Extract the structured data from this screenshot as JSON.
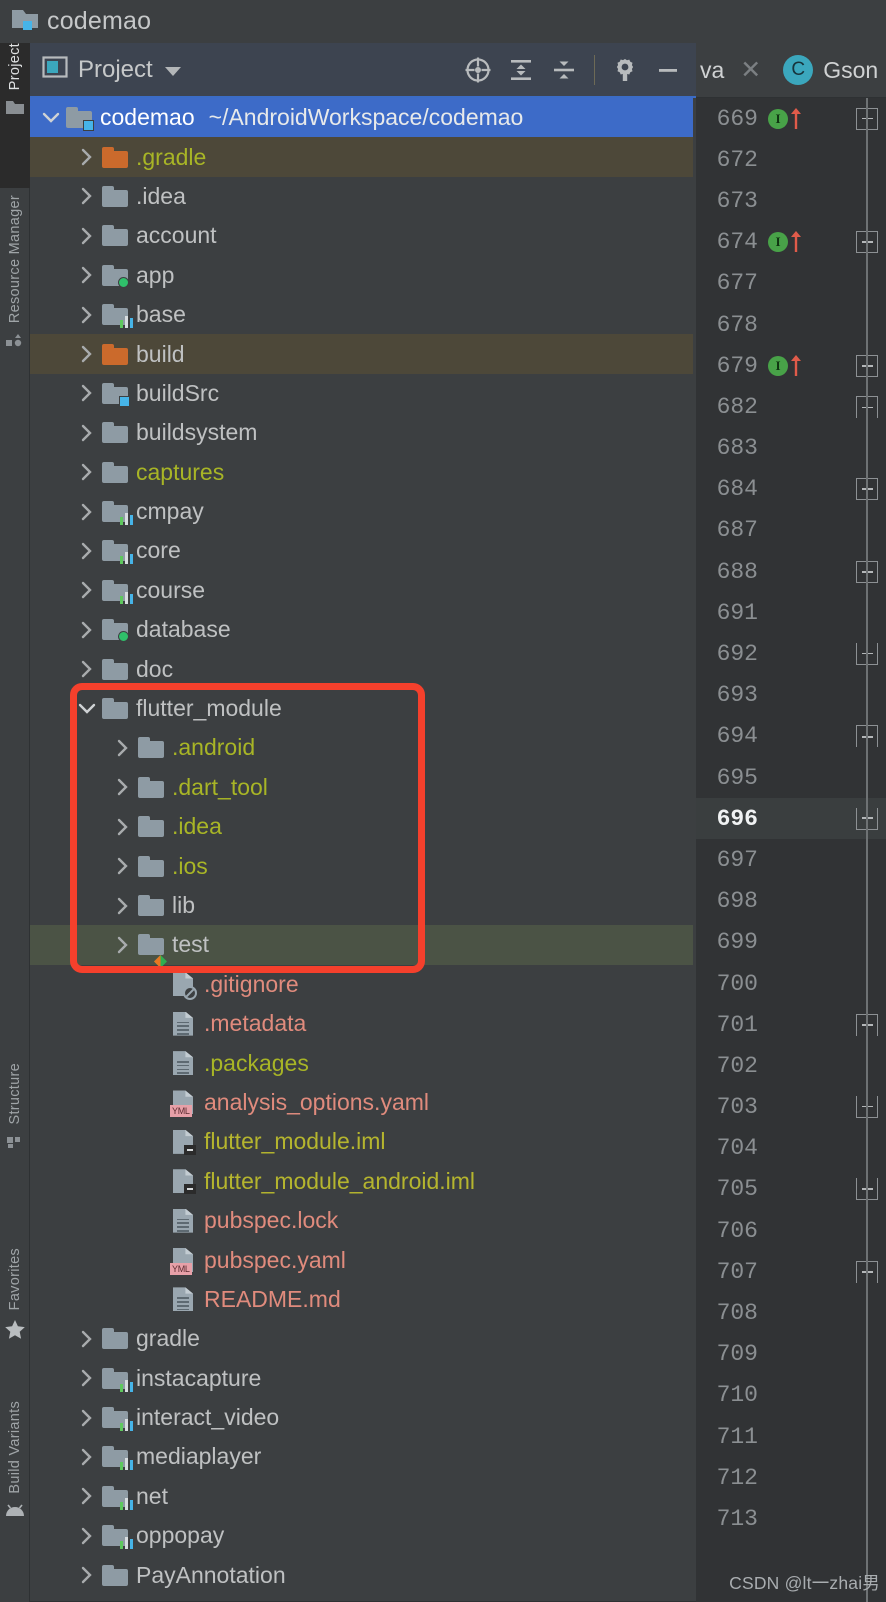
{
  "window": {
    "title": "codemao",
    "title_icon": "project-folder-icon"
  },
  "left_tool_strip": {
    "tabs": [
      {
        "label": "Project",
        "icon": "folder-icon",
        "active": true
      },
      {
        "label": "Resource Manager",
        "icon": "resource-manager-icon",
        "active": false
      },
      {
        "label": "Structure",
        "icon": "structure-squares-icon",
        "active": false
      },
      {
        "label": "Favorites",
        "icon": "star-icon",
        "active": false
      },
      {
        "label": "Build Variants",
        "icon": "android-head-icon",
        "active": false
      }
    ]
  },
  "project_pane": {
    "header": {
      "view_icon": "project-view-icon",
      "title": "Project",
      "dropdown_icon": "chevron-down-icon",
      "tools": [
        {
          "name": "select-opened-file-icon",
          "tooltip": "Select Opened File"
        },
        {
          "name": "expand-all-icon",
          "tooltip": "Expand All"
        },
        {
          "name": "collapse-all-icon",
          "tooltip": "Collapse All"
        },
        {
          "name": "settings-gear-icon",
          "tooltip": "Settings"
        },
        {
          "name": "hide-minimize-icon",
          "tooltip": "Hide"
        }
      ]
    },
    "tree": [
      {
        "label": "codemao",
        "path": "~/AndroidWorkspace/codemao",
        "indent": 0,
        "twisty": "expanded",
        "icon": "folder-module-cyan",
        "color": "white",
        "state": "selected-root"
      },
      {
        "label": ".gradle",
        "indent": 1,
        "twisty": "collapsed",
        "icon": "folder-orange",
        "color": "yellow",
        "state": "excluded"
      },
      {
        "label": ".idea",
        "indent": 1,
        "twisty": "collapsed",
        "icon": "folder-plain",
        "color": "default",
        "state": "normal"
      },
      {
        "label": "account",
        "indent": 1,
        "twisty": "collapsed",
        "icon": "folder-plain",
        "color": "default",
        "state": "normal"
      },
      {
        "label": "app",
        "indent": 1,
        "twisty": "collapsed",
        "icon": "folder-green-dot",
        "color": "default",
        "state": "normal"
      },
      {
        "label": "base",
        "indent": 1,
        "twisty": "collapsed",
        "icon": "folder-bars",
        "color": "default",
        "state": "normal"
      },
      {
        "label": "build",
        "indent": 1,
        "twisty": "collapsed",
        "icon": "folder-orange",
        "color": "default",
        "state": "excluded"
      },
      {
        "label": "buildSrc",
        "indent": 1,
        "twisty": "collapsed",
        "icon": "folder-module-cyan",
        "color": "default",
        "state": "normal"
      },
      {
        "label": "buildsystem",
        "indent": 1,
        "twisty": "collapsed",
        "icon": "folder-plain",
        "color": "default",
        "state": "normal"
      },
      {
        "label": "captures",
        "indent": 1,
        "twisty": "collapsed",
        "icon": "folder-plain",
        "color": "yellow",
        "state": "normal"
      },
      {
        "label": "cmpay",
        "indent": 1,
        "twisty": "collapsed",
        "icon": "folder-bars",
        "color": "default",
        "state": "normal"
      },
      {
        "label": "core",
        "indent": 1,
        "twisty": "collapsed",
        "icon": "folder-bars",
        "color": "default",
        "state": "normal"
      },
      {
        "label": "course",
        "indent": 1,
        "twisty": "collapsed",
        "icon": "folder-bars",
        "color": "default",
        "state": "normal"
      },
      {
        "label": "database",
        "indent": 1,
        "twisty": "collapsed",
        "icon": "folder-green-dot",
        "color": "default",
        "state": "normal"
      },
      {
        "label": "doc",
        "indent": 1,
        "twisty": "collapsed",
        "icon": "folder-plain",
        "color": "default",
        "state": "normal"
      },
      {
        "label": "flutter_module",
        "indent": 1,
        "twisty": "expanded",
        "icon": "folder-plain",
        "color": "default",
        "state": "normal"
      },
      {
        "label": ".android",
        "indent": 2,
        "twisty": "collapsed",
        "icon": "folder-plain",
        "color": "yellow",
        "state": "normal"
      },
      {
        "label": ".dart_tool",
        "indent": 2,
        "twisty": "collapsed",
        "icon": "folder-plain",
        "color": "yellow",
        "state": "normal"
      },
      {
        "label": ".idea",
        "indent": 2,
        "twisty": "collapsed",
        "icon": "folder-plain",
        "color": "yellow",
        "state": "normal"
      },
      {
        "label": ".ios",
        "indent": 2,
        "twisty": "collapsed",
        "icon": "folder-plain",
        "color": "yellow",
        "state": "normal"
      },
      {
        "label": "lib",
        "indent": 2,
        "twisty": "collapsed",
        "icon": "folder-plain",
        "color": "default",
        "state": "normal"
      },
      {
        "label": "test",
        "indent": 2,
        "twisty": "collapsed",
        "icon": "folder-test-diamond",
        "color": "default",
        "state": "green-highlight"
      },
      {
        "label": ".gitignore",
        "indent": 2,
        "twisty": "none",
        "icon": "file-ignored",
        "color": "salmon",
        "state": "normal"
      },
      {
        "label": ".metadata",
        "indent": 2,
        "twisty": "none",
        "icon": "file-text",
        "color": "salmon",
        "state": "normal"
      },
      {
        "label": ".packages",
        "indent": 2,
        "twisty": "none",
        "icon": "file-text",
        "color": "yellow",
        "state": "normal"
      },
      {
        "label": "analysis_options.yaml",
        "indent": 2,
        "twisty": "none",
        "icon": "file-yml",
        "color": "salmon",
        "state": "normal"
      },
      {
        "label": "flutter_module.iml",
        "indent": 2,
        "twisty": "none",
        "icon": "file-iml",
        "color": "olive",
        "state": "normal"
      },
      {
        "label": "flutter_module_android.iml",
        "indent": 2,
        "twisty": "none",
        "icon": "file-iml",
        "color": "olive",
        "state": "normal"
      },
      {
        "label": "pubspec.lock",
        "indent": 2,
        "twisty": "none",
        "icon": "file-text",
        "color": "salmon",
        "state": "normal"
      },
      {
        "label": "pubspec.yaml",
        "indent": 2,
        "twisty": "none",
        "icon": "file-yml",
        "color": "salmon",
        "state": "normal"
      },
      {
        "label": "README.md",
        "indent": 2,
        "twisty": "none",
        "icon": "file-text",
        "color": "salmon",
        "state": "normal"
      },
      {
        "label": "gradle",
        "indent": 1,
        "twisty": "collapsed",
        "icon": "folder-plain",
        "color": "default",
        "state": "normal"
      },
      {
        "label": "instacapture",
        "indent": 1,
        "twisty": "collapsed",
        "icon": "folder-bars",
        "color": "default",
        "state": "normal"
      },
      {
        "label": "interact_video",
        "indent": 1,
        "twisty": "collapsed",
        "icon": "folder-bars",
        "color": "default",
        "state": "normal"
      },
      {
        "label": "mediaplayer",
        "indent": 1,
        "twisty": "collapsed",
        "icon": "folder-bars",
        "color": "default",
        "state": "normal"
      },
      {
        "label": "net",
        "indent": 1,
        "twisty": "collapsed",
        "icon": "folder-bars",
        "color": "default",
        "state": "normal"
      },
      {
        "label": "oppopay",
        "indent": 1,
        "twisty": "collapsed",
        "icon": "folder-bars",
        "color": "default",
        "state": "normal"
      },
      {
        "label": "PayAnnotation",
        "indent": 1,
        "twisty": "collapsed",
        "icon": "folder-plain",
        "color": "default",
        "state": "normal"
      }
    ],
    "annotation": {
      "type": "red-rounded-rectangle",
      "color": "#f5402c",
      "encloses": "flutter_module subtree rows .android through test"
    }
  },
  "editor": {
    "tabs": [
      {
        "label_truncated": "va",
        "close_icon": "close-icon"
      },
      {
        "label": "Gson",
        "icon_letter": "C",
        "icon_color": "#3ba7bd"
      }
    ],
    "gutter_lines": [
      {
        "number": "669",
        "marker": "implementing-method",
        "fold": "plus"
      },
      {
        "number": "672",
        "marker": "",
        "fold": ""
      },
      {
        "number": "673",
        "marker": "",
        "fold": ""
      },
      {
        "number": "674",
        "marker": "implementing-method",
        "fold": "plus"
      },
      {
        "number": "677",
        "marker": "",
        "fold": ""
      },
      {
        "number": "678",
        "marker": "",
        "fold": ""
      },
      {
        "number": "679",
        "marker": "implementing-method",
        "fold": "plus"
      },
      {
        "number": "682",
        "marker": "",
        "fold": "up"
      },
      {
        "number": "683",
        "marker": "",
        "fold": ""
      },
      {
        "number": "684",
        "marker": "",
        "fold": "plus"
      },
      {
        "number": "687",
        "marker": "",
        "fold": ""
      },
      {
        "number": "688",
        "marker": "",
        "fold": "plus"
      },
      {
        "number": "691",
        "marker": "",
        "fold": ""
      },
      {
        "number": "692",
        "marker": "",
        "fold": "down"
      },
      {
        "number": "693",
        "marker": "",
        "fold": ""
      },
      {
        "number": "694",
        "marker": "",
        "fold": "up"
      },
      {
        "number": "695",
        "marker": "",
        "fold": ""
      },
      {
        "number": "696",
        "marker": "",
        "fold": "down",
        "current": true
      },
      {
        "number": "697",
        "marker": "",
        "fold": ""
      },
      {
        "number": "698",
        "marker": "",
        "fold": ""
      },
      {
        "number": "699",
        "marker": "",
        "fold": ""
      },
      {
        "number": "700",
        "marker": "",
        "fold": ""
      },
      {
        "number": "701",
        "marker": "",
        "fold": "up"
      },
      {
        "number": "702",
        "marker": "",
        "fold": ""
      },
      {
        "number": "703",
        "marker": "",
        "fold": "down"
      },
      {
        "number": "704",
        "marker": "",
        "fold": ""
      },
      {
        "number": "705",
        "marker": "",
        "fold": "down"
      },
      {
        "number": "706",
        "marker": "",
        "fold": ""
      },
      {
        "number": "707",
        "marker": "",
        "fold": "up"
      },
      {
        "number": "708",
        "marker": "",
        "fold": ""
      },
      {
        "number": "709",
        "marker": "",
        "fold": ""
      },
      {
        "number": "710",
        "marker": "",
        "fold": ""
      },
      {
        "number": "711",
        "marker": "",
        "fold": ""
      },
      {
        "number": "712",
        "marker": "",
        "fold": ""
      },
      {
        "number": "713",
        "marker": "",
        "fold": ""
      }
    ]
  },
  "watermark": {
    "text": "CSDN @lt一zhai男"
  },
  "colors": {
    "selection_blue": "#3d6bc8",
    "excluded_brown": "#4d4839",
    "test_green": "#4b5345",
    "annotation_red": "#f5402c",
    "accent_cyan": "#46b4e8",
    "folder_gray": "#8e9ba4",
    "folder_orange": "#cb6a2c"
  }
}
